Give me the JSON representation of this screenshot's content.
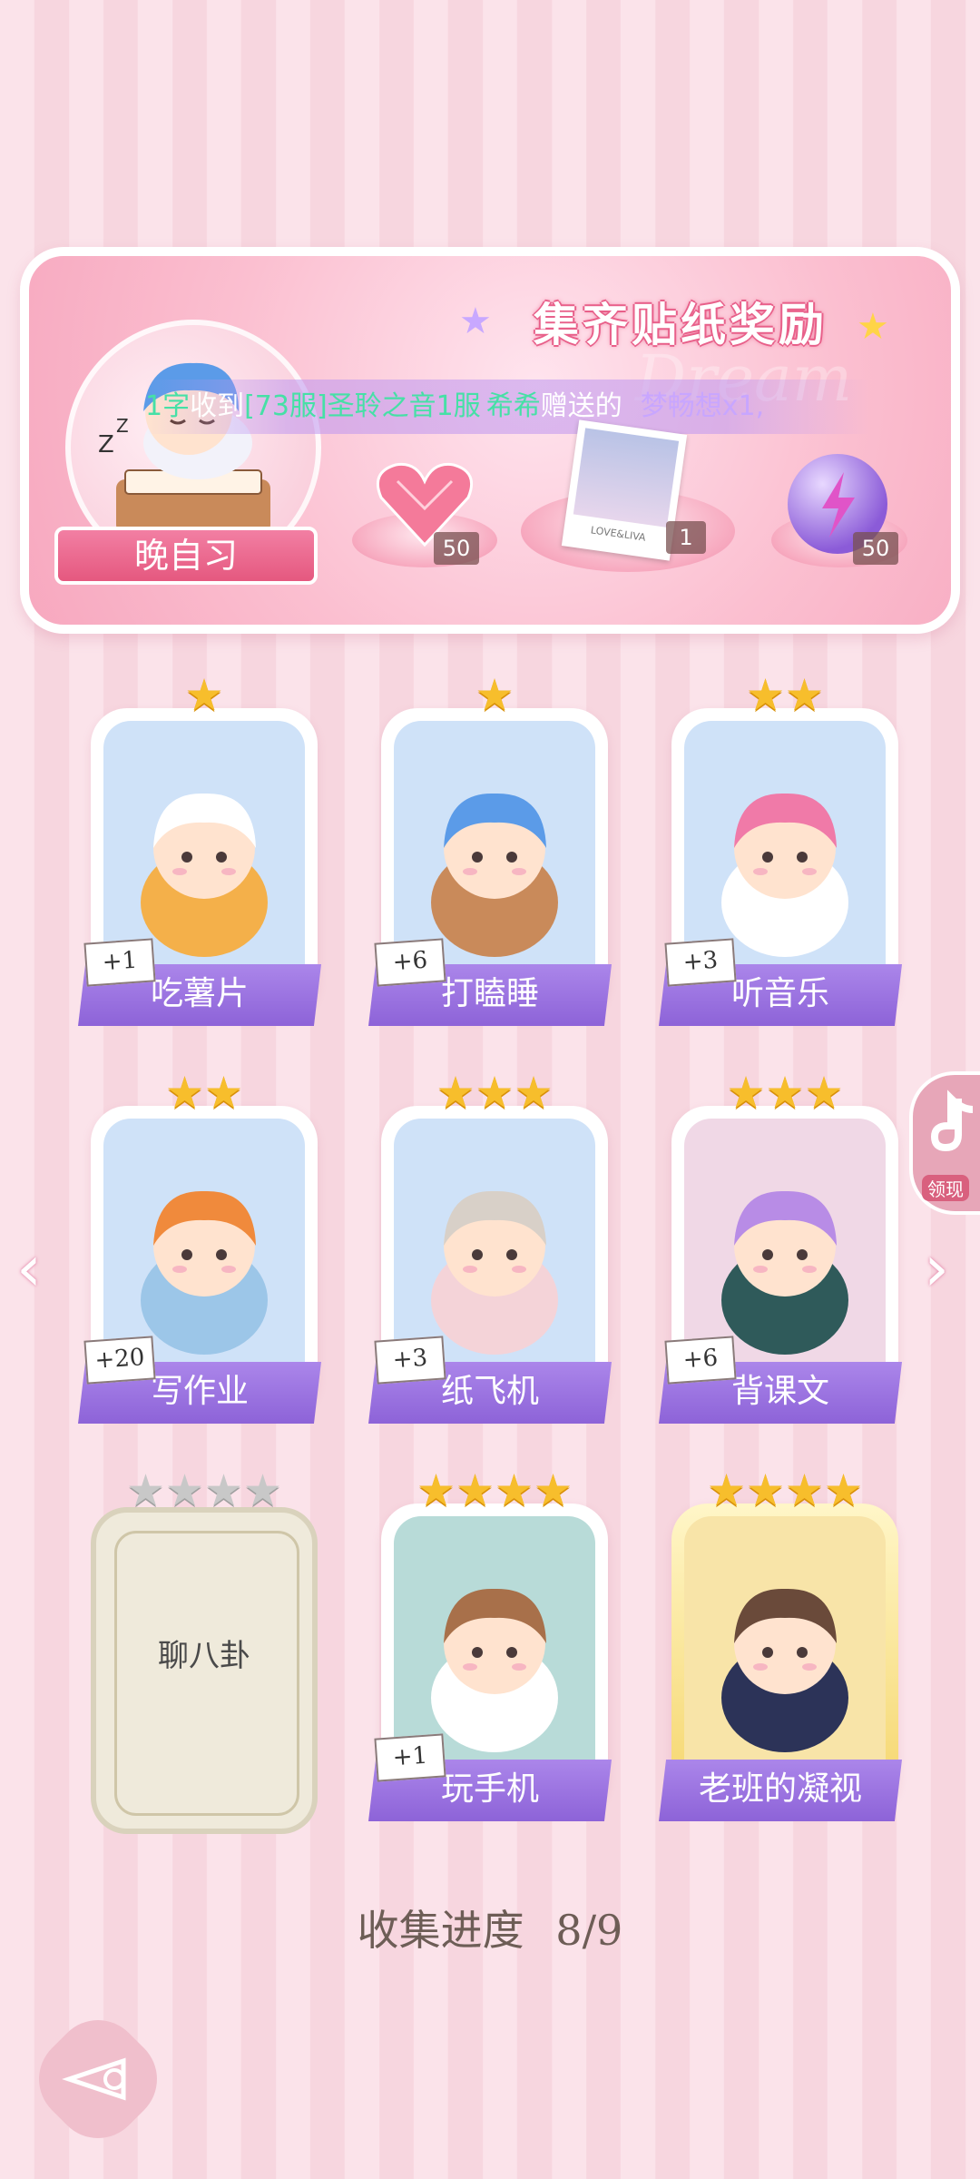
{
  "banner": {
    "title": "集齐贴纸奖励",
    "ticker": {
      "sender": "1字",
      "received_text": "收到",
      "server": "[73服]圣聆之音1服",
      "gifter": "希希",
      "gift_text": "赠送的",
      "item": "梦畅想x1,"
    },
    "watermark": "Dream",
    "avatar_label": "晚自习",
    "rewards": [
      {
        "icon": "heart-gem-icon",
        "count": "50"
      },
      {
        "icon": "photo-card-icon",
        "count": "1"
      },
      {
        "icon": "energy-orb-icon",
        "count": "50"
      }
    ],
    "photo_caption": "LOVE&LIVA"
  },
  "stickers": [
    {
      "name": "吃薯片",
      "stars": 1,
      "count": "+1",
      "collected": true,
      "art": "cat-eating-chips"
    },
    {
      "name": "打瞌睡",
      "stars": 1,
      "count": "+6",
      "collected": true,
      "art": "boy-sleeping-desk"
    },
    {
      "name": "听音乐",
      "stars": 2,
      "count": "+3",
      "collected": true,
      "art": "girl-headphones"
    },
    {
      "name": "写作业",
      "stars": 2,
      "count": "+20",
      "collected": true,
      "art": "boy-homework"
    },
    {
      "name": "纸飞机",
      "stars": 3,
      "count": "+3",
      "collected": true,
      "art": "cat-paper-plane"
    },
    {
      "name": "背课文",
      "stars": 3,
      "count": "+6",
      "collected": true,
      "art": "girl-reciting"
    },
    {
      "name": "聊八卦",
      "stars": 4,
      "count": "",
      "collected": false,
      "art": "locked"
    },
    {
      "name": "玩手机",
      "stars": 4,
      "count": "+1",
      "collected": true,
      "art": "girl-phone"
    },
    {
      "name": "老班的凝视",
      "stars": 4,
      "count": "",
      "collected": true,
      "art": "teacher-glasses"
    }
  ],
  "progress": {
    "label": "收集进度",
    "value": "8/9"
  },
  "side_widget": {
    "label": "领现"
  },
  "colors": {
    "ribbon": "#9b73e0",
    "star": "#f7be2c",
    "banner": "#f7a8bf",
    "background": "#fbe3ea"
  }
}
